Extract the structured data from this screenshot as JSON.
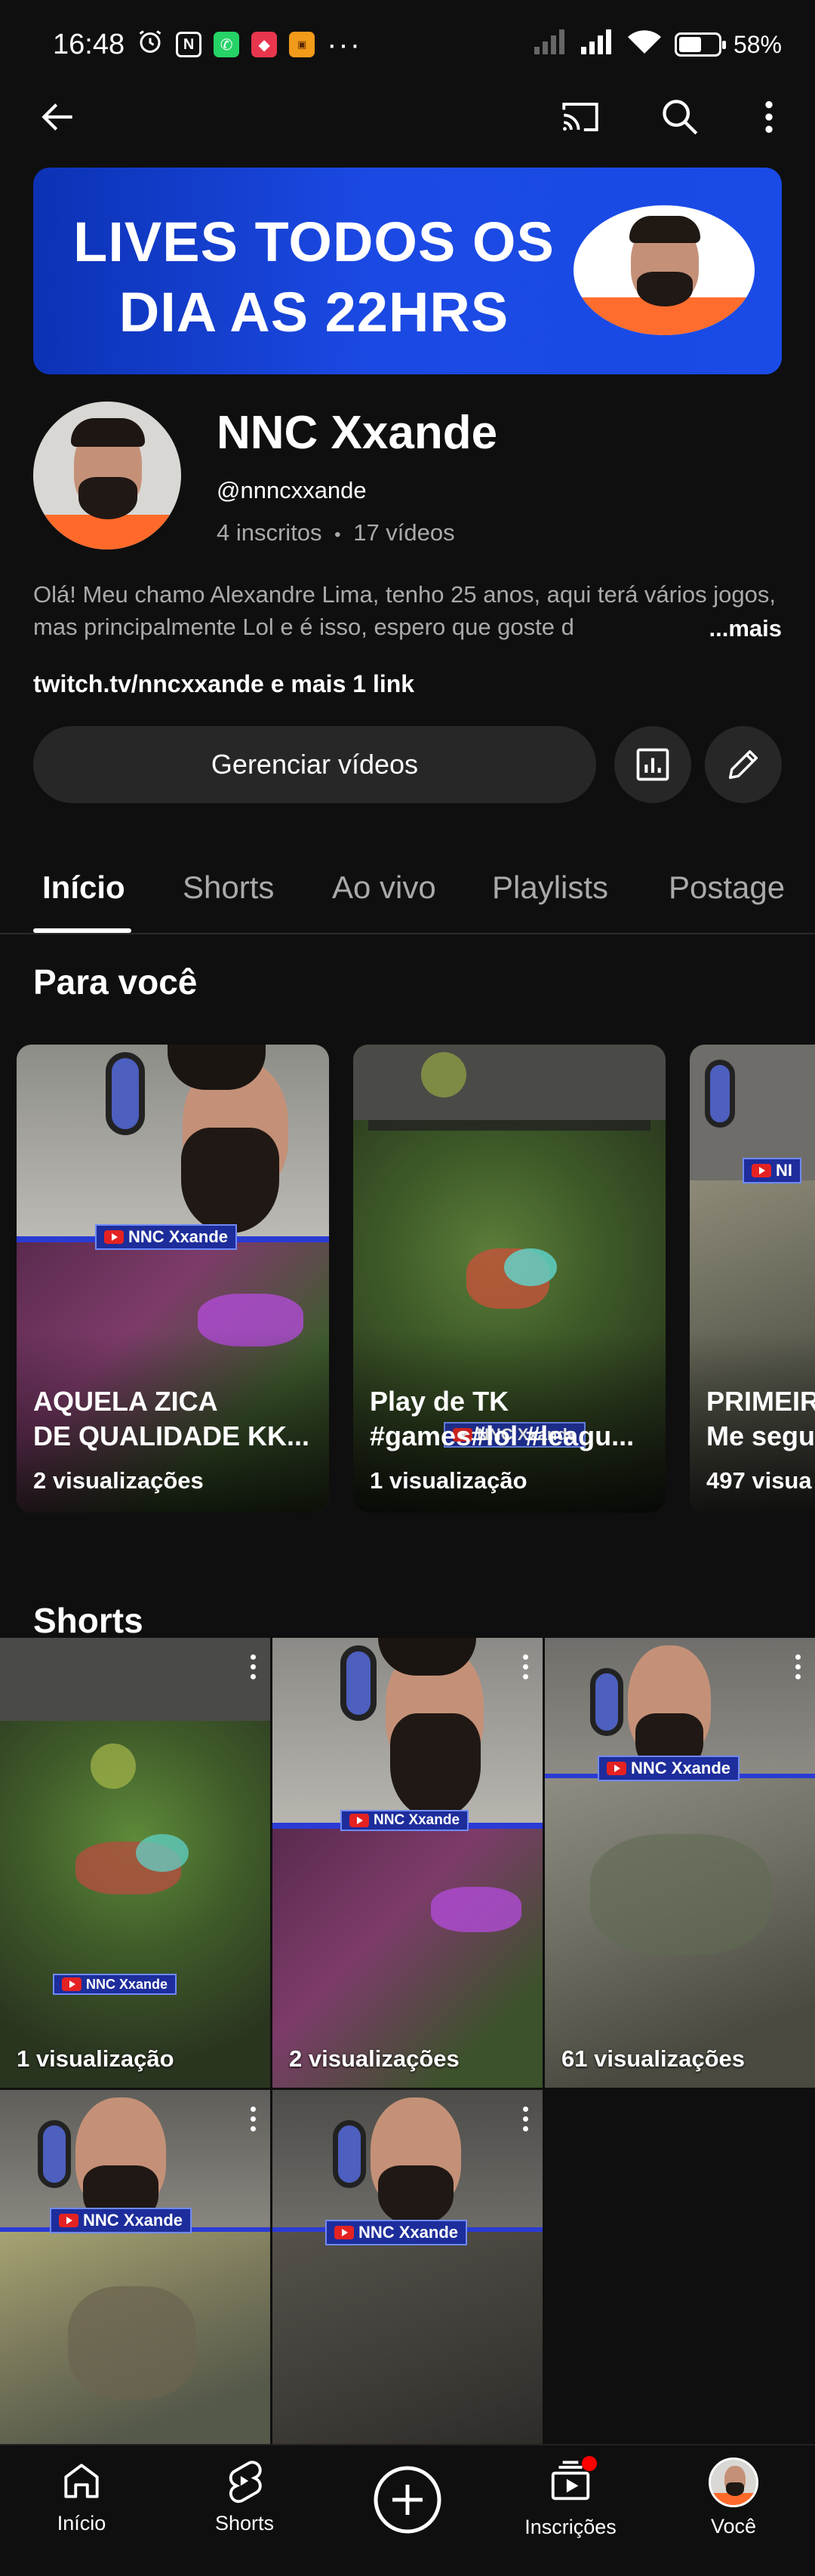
{
  "status_bar": {
    "time": "16:48",
    "battery": "58%",
    "battery_level": 0.58
  },
  "top_bar": {
    "back_icon": "arrow-left-icon",
    "cast_icon": "cast-icon",
    "search_icon": "search-icon",
    "more_icon": "more-vert-icon"
  },
  "banner": {
    "line1": "LIVES TODOS OS",
    "line2": "DIA AS 22HRS"
  },
  "channel": {
    "name": "NNC Xxande",
    "handle": "@nnncxxande",
    "subscribers": "4 inscritos",
    "separator": "•",
    "videos": "17 vídeos",
    "description": "Olá! Meu chamo Alexandre Lima, tenho 25 anos, aqui terá vários jogos, mas principalmente Lol e é isso, espero que goste d",
    "more_label": "...mais",
    "link": "twitch.tv/nncxxande",
    "link_more": " e mais 1 link"
  },
  "actions": {
    "manage_label": "Gerenciar vídeos",
    "analytics_icon": "analytics-icon",
    "edit_icon": "pencil-icon"
  },
  "tabs": [
    "Início",
    "Shorts",
    "Ao vivo",
    "Playlists",
    "Postage"
  ],
  "for_you": {
    "title": "Para você",
    "cards": [
      {
        "title_line1": "AQUELA ZICA",
        "title_line2": "DE QUALIDADE KK...",
        "views": "2 visualizações"
      },
      {
        "title_line1": "Play de TK",
        "title_line2": "#games#lol #leagu...",
        "views": "1 visualização"
      },
      {
        "title_line1": "PRIMEIR",
        "title_line2": "Me segu",
        "views": "497 visua"
      }
    ]
  },
  "shorts": {
    "title": "Shorts",
    "items": [
      {
        "views": "1 visualização"
      },
      {
        "views": "2 visualizações"
      },
      {
        "views": "61 visualizações"
      },
      {
        "views": ""
      },
      {
        "views": ""
      }
    ]
  },
  "overlay_tag": "NNC Xxande",
  "overlay_tag_short": "NI",
  "bottom_nav": [
    {
      "label": "Início",
      "icon": "home-icon"
    },
    {
      "label": "Shorts",
      "icon": "shorts-icon"
    },
    {
      "label": "",
      "icon": "create-icon"
    },
    {
      "label": "Inscrições",
      "icon": "subscriptions-icon"
    },
    {
      "label": "Você",
      "icon": "avatar-icon"
    }
  ],
  "colors": {
    "background": "#0f0f0f",
    "banner_blue": "#1b49e3",
    "button_bg": "#272727",
    "notification_red": "#ff0000"
  }
}
